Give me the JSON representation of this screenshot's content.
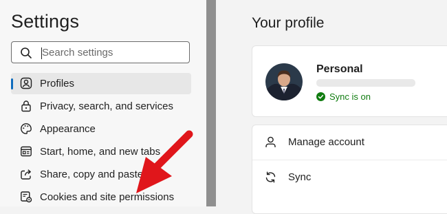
{
  "sidebar": {
    "title": "Settings",
    "search": {
      "placeholder": "Search settings",
      "value": ""
    },
    "items": [
      {
        "label": "Profiles",
        "icon": "profile-icon",
        "active": true
      },
      {
        "label": "Privacy, search, and services",
        "icon": "lock-icon"
      },
      {
        "label": "Appearance",
        "icon": "palette-icon"
      },
      {
        "label": "Start, home, and new tabs",
        "icon": "home-tabs-icon"
      },
      {
        "label": "Share, copy and paste",
        "icon": "share-icon"
      },
      {
        "label": "Cookies and site permissions",
        "icon": "cookies-permissions-icon"
      }
    ]
  },
  "main": {
    "title": "Your profile",
    "profile": {
      "name": "Personal",
      "sync_status": "Sync is on"
    },
    "actions": [
      {
        "label": "Manage account",
        "icon": "person-icon"
      },
      {
        "label": "Sync",
        "icon": "sync-icon"
      }
    ]
  },
  "colors": {
    "accent": "#0f6cbd",
    "sync_green": "#107c10",
    "annotation_red": "#e0161b",
    "divider": "#8f8f8f"
  }
}
